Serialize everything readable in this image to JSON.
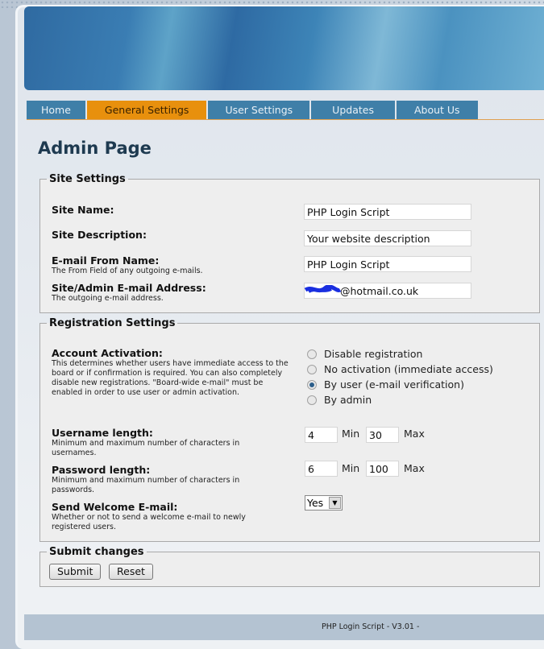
{
  "nav": {
    "tabs": [
      {
        "label": "Home",
        "active": false
      },
      {
        "label": "General Settings",
        "active": true
      },
      {
        "label": "User Settings",
        "active": false
      },
      {
        "label": "Updates",
        "active": false
      },
      {
        "label": "About Us",
        "active": false
      }
    ]
  },
  "page_title": "Admin Page",
  "site_settings": {
    "legend": "Site Settings",
    "site_name": {
      "label": "Site Name:",
      "value": "PHP Login Script"
    },
    "site_description": {
      "label": "Site Description:",
      "value": "Your website description"
    },
    "email_from_name": {
      "label": "E-mail From Name:",
      "desc": "The From Field of any outgoing e-mails.",
      "value": "PHP Login Script"
    },
    "admin_email": {
      "label": "Site/Admin E-mail Address:",
      "desc": "The outgoing e-mail address.",
      "value": "@hotmail.co.uk"
    }
  },
  "registration": {
    "legend": "Registration Settings",
    "activation": {
      "label": "Account Activation:",
      "desc": "This determines whether users have immediate access to the board or if confirmation is required. You can also completely disable new registrations. \"Board-wide e-mail\" must be enabled in order to use user or admin activation.",
      "options": [
        "Disable registration",
        "No activation (immediate access)",
        "By user (e-mail verification)",
        "By admin"
      ],
      "selected": "By user (e-mail verification)"
    },
    "username_length": {
      "label": "Username length:",
      "desc": "Minimum and maximum number of characters in usernames.",
      "min": "4",
      "max": "30"
    },
    "password_length": {
      "label": "Password length:",
      "desc": "Minimum and maximum number of characters in passwords.",
      "min": "6",
      "max": "100"
    },
    "min_label": "Min",
    "max_label": "Max",
    "welcome_email": {
      "label": "Send Welcome E-mail:",
      "desc": "Whether or not to send a welcome e-mail to newly registered users.",
      "value": "Yes"
    }
  },
  "submit": {
    "legend": "Submit changes",
    "submit_label": "Submit",
    "reset_label": "Reset"
  },
  "footer": "PHP Login Script - V3.01 -",
  "colors": {
    "active_tab": "#e8900d",
    "tab": "#3f7fa8",
    "redaction": "#1a2fe0"
  }
}
